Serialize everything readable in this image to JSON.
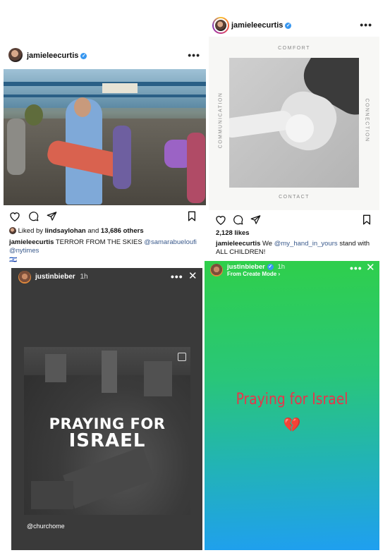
{
  "post1": {
    "username": "jamieleecurtis",
    "more": "•••",
    "liked_by_prefix": "Liked by",
    "liked_by_user": "lindsaylohan",
    "liked_by_middle": "and",
    "liked_by_count": "13,686 others",
    "caption_user": "jamieleecurtis",
    "caption_text": "TERROR FROM THE SKIES",
    "mention1": "@samarabueloufi",
    "mention2": "@nytimes",
    "caption_flag": "🇮🇱"
  },
  "post2": {
    "username": "jamieleecurtis",
    "more": "•••",
    "image_top": "COMFORT",
    "image_bottom": "CONTACT",
    "image_left": "COMMUNICATION",
    "image_right": "CONNECTION",
    "likes": "2,128 likes",
    "caption_user": "jamieleecurtis",
    "caption_pre": "We",
    "mention": "@my_hand_in_yours",
    "caption_post": "stand with ALL CHILDREN!"
  },
  "story1": {
    "username": "justinbieber",
    "time": "1h",
    "more": "•••",
    "close": "✕",
    "headline1": "PRAYING FOR",
    "headline2": "ISRAEL",
    "credit": "@churchome"
  },
  "story2": {
    "username": "justinbieber",
    "time": "1h",
    "subtitle": "From Create Mode ›",
    "more": "•••",
    "close": "✕",
    "message": "Praying for Israel",
    "emoji": "💔"
  },
  "colors": {
    "link": "#3a5a8c",
    "verified": "#3897f0",
    "story2_gradient_top": "#2fcf4a",
    "story2_gradient_bottom": "#1f9ff0",
    "story2_text": "#e8344a"
  },
  "icons": [
    "heart-icon",
    "comment-icon",
    "share-icon",
    "bookmark-icon",
    "verified-icon",
    "close-icon"
  ]
}
